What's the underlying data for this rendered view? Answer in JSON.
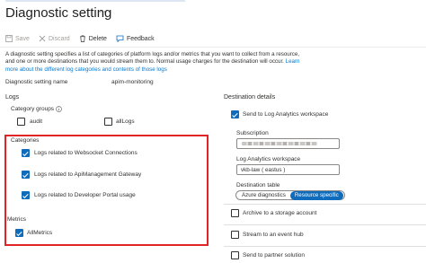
{
  "page": {
    "title": "Diagnostic setting",
    "more_dots": "···"
  },
  "toolbar": {
    "save_label": "Save",
    "discard_label": "Discard",
    "delete_label": "Delete",
    "feedback_label": "Feedback"
  },
  "description": {
    "line1": "A diagnostic setting specifies a list of categories of platform logs and/or metrics that you want to collect from a resource,",
    "line2": "and one or more destinations that you would stream them to. Normal usage charges for the destination will occur.",
    "learn_more_inline": "Learn",
    "line3": "more about the different log categories and contents of those logs"
  },
  "settings": {
    "name_label": "Diagnostic setting name",
    "name_value": "apim-monitoring"
  },
  "logs": {
    "heading": "Logs",
    "category_groups_label": "Category groups",
    "category_groups": [
      {
        "label": "audit",
        "checked": false
      },
      {
        "label": "allLogs",
        "checked": false
      }
    ],
    "categories_heading": "Categories",
    "categories": [
      {
        "label": "Logs related to Websocket Connections",
        "checked": true
      },
      {
        "label": "Logs related to ApiManagement Gateway",
        "checked": true
      },
      {
        "label": "Logs related to Developer Portal usage",
        "checked": true
      }
    ]
  },
  "metrics": {
    "heading": "Metrics",
    "items": [
      {
        "label": "AllMetrics",
        "checked": true
      }
    ]
  },
  "destination": {
    "heading": "Destination details",
    "send_to_la": {
      "label": "Send to Log Analytics workspace",
      "checked": true
    },
    "subscription_label": "Subscription",
    "workspace_label": "Log Analytics workspace",
    "workspace_value": "vkb-law ( eastus )",
    "table_label": "Destination table",
    "table_options": [
      "Azure diagnostics",
      "Resource specific"
    ],
    "table_selected": "Resource specific",
    "archive": {
      "label": "Archive to a storage account",
      "checked": false
    },
    "event_hub": {
      "label": "Stream to an event hub",
      "checked": false
    },
    "partner": {
      "label": "Send to partner solution",
      "checked": false
    }
  },
  "colors": {
    "accent": "#0f6cbd",
    "highlight_border": "#e02424",
    "link": "#0078d4"
  }
}
